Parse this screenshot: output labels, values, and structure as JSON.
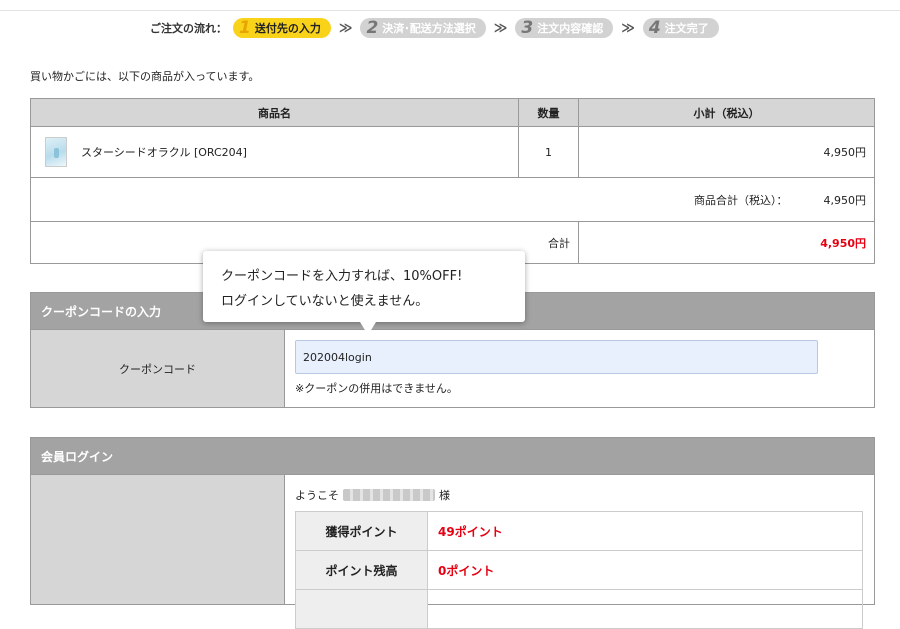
{
  "steps": {
    "label": "ご注文の流れ：",
    "items": [
      {
        "num": "1",
        "label": "送付先の入力"
      },
      {
        "num": "2",
        "label": "決済･配送方法選択"
      },
      {
        "num": "3",
        "label": "注文内容確認"
      },
      {
        "num": "4",
        "label": "注文完了"
      }
    ],
    "separator": "≫"
  },
  "intro": "買い物かごには、以下の商品が入っています。",
  "cart": {
    "headers": {
      "name": "商品名",
      "qty": "数量",
      "subtotal": "小計（税込）"
    },
    "items": [
      {
        "name": "スターシードオラクル [ORC204]",
        "qty": "1",
        "price": "4,950円"
      }
    ],
    "goods_total_label": "商品合計（税込）：",
    "goods_total_value": "4,950円",
    "total_label": "合計",
    "total_value": "4,950円"
  },
  "tooltip": {
    "line1": "クーポンコードを入力すれば、10%OFF!",
    "line2": "ログインしていないと使えません。"
  },
  "coupon": {
    "heading": "クーポンコードの入力",
    "label": "クーポンコード",
    "value": "202004login",
    "note": "※クーポンの併用はできません。"
  },
  "member": {
    "heading": "会員ログイン",
    "welcome_prefix": "ようこそ",
    "welcome_suffix": "様",
    "points": [
      {
        "label": "獲得ポイント",
        "value": "49ポイント"
      },
      {
        "label": "ポイント残高",
        "value": "0ポイント"
      }
    ]
  },
  "colors": {
    "accent_red": "#e60012",
    "active_step": "#f9d21a",
    "header_gray": "#a3a3a3"
  }
}
